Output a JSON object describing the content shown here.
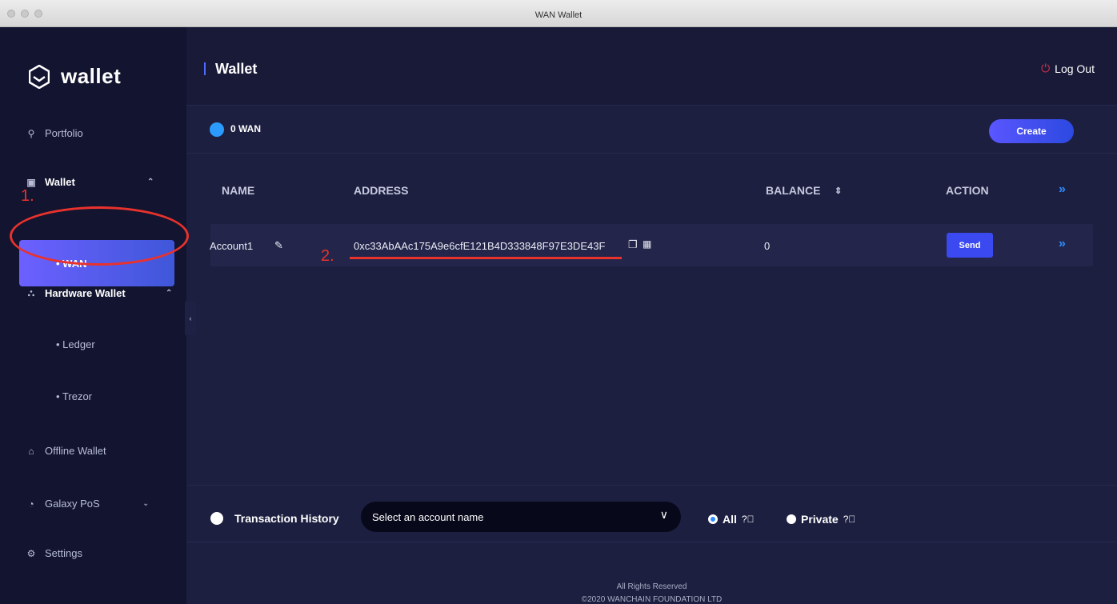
{
  "window": {
    "title": "WAN Wallet"
  },
  "sidebar": {
    "logo_text": "wallet",
    "items": [
      {
        "label": "Portfolio",
        "icon": "user-icon"
      },
      {
        "label": "Wallet",
        "icon": "wallet-icon"
      },
      {
        "label": "• WAN"
      },
      {
        "label": "Hardware Wallet",
        "icon": "hardware-icon"
      },
      {
        "label": "• Ledger"
      },
      {
        "label": "• Trezor"
      },
      {
        "label": "Offline Wallet",
        "icon": "bank-icon"
      },
      {
        "label": "Galaxy PoS",
        "icon": "pos-icon"
      },
      {
        "label": "Settings",
        "icon": "settings-icon"
      }
    ]
  },
  "header": {
    "title": "Wallet",
    "logout": "Log Out"
  },
  "balance": {
    "text": "0 WAN"
  },
  "create_label": "Create",
  "table": {
    "headers": {
      "name": "NAME",
      "address": "ADDRESS",
      "balance": "BALANCE",
      "sort": "⇕",
      "action": "ACTION"
    },
    "rows": [
      {
        "name": "Account1",
        "address": "0xc33AbAAc175A9e6cfE121B4D333848F97E3DE43F",
        "balance": "0",
        "action": "Send"
      }
    ]
  },
  "transactions": {
    "label": "Transaction History",
    "select_placeholder": "Select an account name",
    "filter_all": "All",
    "filter_private": "Private"
  },
  "footer": {
    "line1": "All Rights Reserved",
    "line2": "©2020 WANCHAIN FOUNDATION LTD"
  },
  "annotations": {
    "one": "1.",
    "two": "2."
  },
  "colors": {
    "accent": "#3b49f0",
    "annotation": "#e8322c",
    "logout": "#e0324a"
  }
}
